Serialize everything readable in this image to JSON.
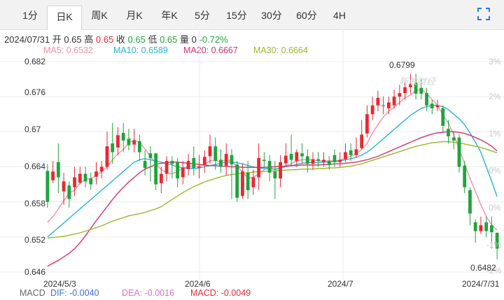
{
  "tabs": [
    {
      "label": "1分",
      "active": false
    },
    {
      "label": "日K",
      "active": true
    },
    {
      "label": "周K",
      "active": false
    },
    {
      "label": "月K",
      "active": false
    },
    {
      "label": "年K",
      "active": false
    },
    {
      "label": "5分",
      "active": false
    },
    {
      "label": "15分",
      "active": false
    },
    {
      "label": "30分",
      "active": false
    },
    {
      "label": "60分",
      "active": false
    },
    {
      "label": "4H",
      "active": false
    }
  ],
  "info": {
    "date": "2024/07/31",
    "open_label": "开",
    "open": "0.65",
    "high_label": "高",
    "high": "0.65",
    "close_label": "收",
    "close": "0.65",
    "low_label": "低",
    "low": "0.65",
    "vol_label": "量",
    "vol": "0",
    "change": "-0.72%"
  },
  "ma_legend": [
    {
      "text": "MA5: 0.6532",
      "color": "#f58fa5"
    },
    {
      "text": "MA10: 0.6589",
      "color": "#27b4d8"
    },
    {
      "text": "MA20: 0.6667",
      "color": "#d9326a"
    },
    {
      "text": "MA30: 0.6664",
      "color": "#9ab92a"
    }
  ],
  "macd_legend": {
    "title": "MACD",
    "dif": "DIF: -0.0040",
    "dea": "DEA: -0.0016",
    "macd": "MACD: -0.0049"
  },
  "watermark": "新浪财经",
  "colors": {
    "up": "#e8292e",
    "down": "#1fa43c",
    "grid": "#ececec"
  },
  "chart_data": {
    "type": "candlestick",
    "price_ticks": [
      "0.682",
      "0.676",
      "0.67",
      "0.664",
      "0.658",
      "0.652",
      "0.646"
    ],
    "pct_ticks": [
      "3%",
      "2%",
      "1%",
      "0%",
      "0%",
      "-1%",
      "-2%"
    ],
    "date_ticks": [
      "2024/5/3",
      "2024/6",
      "2024/7",
      "2024/7/31"
    ],
    "ylim": [
      0.646,
      0.682
    ],
    "high_mark": "0.6799",
    "low_mark": "0.6482",
    "candles": [
      [
        0.6633,
        0.658,
        0.6645,
        0.657
      ],
      [
        0.6617,
        0.6632,
        0.665,
        0.6612
      ],
      [
        0.6648,
        0.6622,
        0.668,
        0.6595
      ],
      [
        0.6598,
        0.6615,
        0.663,
        0.6575
      ],
      [
        0.6608,
        0.6585,
        0.6615,
        0.657
      ],
      [
        0.6605,
        0.6622,
        0.664,
        0.659
      ],
      [
        0.6613,
        0.6628,
        0.664,
        0.661
      ],
      [
        0.6628,
        0.6615,
        0.664,
        0.6605
      ],
      [
        0.662,
        0.661,
        0.663,
        0.66
      ],
      [
        0.6623,
        0.6632,
        0.6648,
        0.661
      ],
      [
        0.6632,
        0.664,
        0.665,
        0.662
      ],
      [
        0.664,
        0.6675,
        0.67,
        0.6635
      ],
      [
        0.668,
        0.6665,
        0.6715,
        0.6645
      ],
      [
        0.6673,
        0.6694,
        0.6708,
        0.666
      ],
      [
        0.6698,
        0.6685,
        0.6715,
        0.6665
      ],
      [
        0.6688,
        0.6677,
        0.6705,
        0.6668
      ],
      [
        0.6678,
        0.6685,
        0.6705,
        0.6665
      ],
      [
        0.6684,
        0.6665,
        0.6695,
        0.665
      ],
      [
        0.665,
        0.6638,
        0.6668,
        0.6625
      ],
      [
        0.6663,
        0.6655,
        0.6675,
        0.6615
      ],
      [
        0.6663,
        0.661,
        0.6655,
        0.66
      ],
      [
        0.6612,
        0.6628,
        0.664,
        0.6595
      ],
      [
        0.6628,
        0.665,
        0.6658,
        0.6615
      ],
      [
        0.665,
        0.6645,
        0.6658,
        0.662
      ],
      [
        0.6648,
        0.662,
        0.6655,
        0.6605
      ],
      [
        0.6622,
        0.6638,
        0.665,
        0.661
      ],
      [
        0.6636,
        0.665,
        0.6662,
        0.6625
      ],
      [
        0.6655,
        0.6638,
        0.6675,
        0.6625
      ],
      [
        0.6638,
        0.664,
        0.666,
        0.662
      ],
      [
        0.6643,
        0.6657,
        0.6668,
        0.663
      ],
      [
        0.6658,
        0.6675,
        0.6695,
        0.6645
      ],
      [
        0.6675,
        0.665,
        0.669,
        0.6635
      ],
      [
        0.6652,
        0.664,
        0.667,
        0.663
      ],
      [
        0.6642,
        0.6662,
        0.668,
        0.6625
      ],
      [
        0.666,
        0.6644,
        0.667,
        0.6585
      ],
      [
        0.6644,
        0.6587,
        0.665,
        0.658
      ],
      [
        0.659,
        0.6632,
        0.6645,
        0.6585
      ],
      [
        0.663,
        0.66,
        0.665,
        0.6585
      ],
      [
        0.6605,
        0.6622,
        0.6635,
        0.6592
      ],
      [
        0.6622,
        0.6655,
        0.668,
        0.66
      ],
      [
        0.6652,
        0.665,
        0.6665,
        0.664
      ],
      [
        0.665,
        0.663,
        0.666,
        0.6615
      ],
      [
        0.6632,
        0.662,
        0.665,
        0.6585
      ],
      [
        0.662,
        0.6648,
        0.666,
        0.6605
      ],
      [
        0.6646,
        0.6659,
        0.668,
        0.664
      ],
      [
        0.6662,
        0.6652,
        0.6695,
        0.664
      ],
      [
        0.665,
        0.6665,
        0.667,
        0.664
      ],
      [
        0.6663,
        0.6658,
        0.668,
        0.6645
      ],
      [
        0.6658,
        0.6645,
        0.667,
        0.663
      ],
      [
        0.6645,
        0.6653,
        0.6665,
        0.6635
      ],
      [
        0.6653,
        0.665,
        0.6665,
        0.664
      ],
      [
        0.6648,
        0.6652,
        0.6665,
        0.664
      ],
      [
        0.665,
        0.6643,
        0.6658,
        0.6635
      ],
      [
        0.666,
        0.6648,
        0.667,
        0.664
      ],
      [
        0.6648,
        0.6652,
        0.6665,
        0.664
      ],
      [
        0.6653,
        0.6665,
        0.668,
        0.6648
      ],
      [
        0.6668,
        0.666,
        0.668,
        0.665
      ],
      [
        0.666,
        0.667,
        0.669,
        0.6655
      ],
      [
        0.6672,
        0.6695,
        0.672,
        0.667
      ],
      [
        0.6697,
        0.673,
        0.6745,
        0.669
      ],
      [
        0.673,
        0.6745,
        0.676,
        0.672
      ],
      [
        0.6745,
        0.6758,
        0.677,
        0.6735
      ],
      [
        0.6745,
        0.6745,
        0.676,
        0.673
      ],
      [
        0.674,
        0.675,
        0.676,
        0.673
      ],
      [
        0.6745,
        0.676,
        0.6772,
        0.674
      ],
      [
        0.676,
        0.6766,
        0.678,
        0.6745
      ],
      [
        0.6766,
        0.6776,
        0.6786,
        0.6755
      ],
      [
        0.6776,
        0.6782,
        0.6799,
        0.6765
      ],
      [
        0.6784,
        0.6765,
        0.6799,
        0.6755
      ],
      [
        0.6775,
        0.6765,
        0.679,
        0.6755
      ],
      [
        0.6766,
        0.6745,
        0.6775,
        0.6735
      ],
      [
        0.6748,
        0.674,
        0.6755,
        0.673
      ],
      [
        0.6742,
        0.6745,
        0.6755,
        0.6735
      ],
      [
        0.674,
        0.671,
        0.6745,
        0.67
      ],
      [
        0.6705,
        0.6692,
        0.672,
        0.668
      ],
      [
        0.669,
        0.6685,
        0.67,
        0.667
      ],
      [
        0.669,
        0.664,
        0.6695,
        0.663
      ],
      [
        0.6642,
        0.6605,
        0.665,
        0.6595
      ],
      [
        0.66,
        0.656,
        0.6605,
        0.654
      ],
      [
        0.6545,
        0.653,
        0.655,
        0.651
      ],
      [
        0.653,
        0.654,
        0.6555,
        0.6525
      ],
      [
        0.6545,
        0.653,
        0.6555,
        0.652
      ],
      [
        0.654,
        0.6528,
        0.6555,
        0.65
      ],
      [
        0.6527,
        0.65,
        0.6528,
        0.6482
      ]
    ],
    "ma_series": [
      {
        "name": "MA5",
        "color": "#f58fa5",
        "values": [
          0.6545,
          0.6555,
          0.6568,
          0.6582,
          0.6595,
          0.66,
          0.6612,
          0.6618,
          0.662,
          0.6625,
          0.6632,
          0.664,
          0.6652,
          0.6662,
          0.667,
          0.668,
          0.6686,
          0.6682,
          0.667,
          0.6658,
          0.6645,
          0.6635,
          0.663,
          0.6628,
          0.6632,
          0.6638,
          0.664,
          0.6642,
          0.664,
          0.6645,
          0.665,
          0.6651,
          0.6649,
          0.6652,
          0.665,
          0.664,
          0.6632,
          0.662,
          0.6622,
          0.6628,
          0.6635,
          0.664,
          0.6635,
          0.6638,
          0.6642,
          0.6645,
          0.665,
          0.6652,
          0.6652,
          0.6652,
          0.665,
          0.665,
          0.665,
          0.665,
          0.6651,
          0.6655,
          0.6658,
          0.6662,
          0.667,
          0.668,
          0.6698,
          0.6712,
          0.6725,
          0.6735,
          0.6742,
          0.675,
          0.6758,
          0.6763,
          0.677,
          0.6772,
          0.6765,
          0.6755,
          0.6745,
          0.6728,
          0.6715,
          0.6695,
          0.667,
          0.6645,
          0.662,
          0.6598,
          0.6575,
          0.6555,
          0.654,
          0.6532
        ]
      },
      {
        "name": "MA10",
        "color": "#27b4d8",
        "values": [
          0.652,
          0.6528,
          0.6536,
          0.6544,
          0.6552,
          0.656,
          0.6568,
          0.6576,
          0.6584,
          0.6592,
          0.66,
          0.6608,
          0.6616,
          0.6624,
          0.6632,
          0.664,
          0.6648,
          0.6652,
          0.6654,
          0.6652,
          0.665,
          0.6648,
          0.6645,
          0.6643,
          0.664,
          0.6638,
          0.6637,
          0.6637,
          0.6638,
          0.664,
          0.6642,
          0.6644,
          0.6646,
          0.6648,
          0.6648,
          0.6647,
          0.6645,
          0.6642,
          0.664,
          0.6638,
          0.6637,
          0.6636,
          0.6636,
          0.6638,
          0.664,
          0.6642,
          0.6644,
          0.6646,
          0.6647,
          0.6647,
          0.6647,
          0.6648,
          0.6648,
          0.6649,
          0.665,
          0.6652,
          0.6654,
          0.6656,
          0.666,
          0.6665,
          0.6672,
          0.668,
          0.6688,
          0.6696,
          0.6704,
          0.6712,
          0.672,
          0.6728,
          0.6734,
          0.674,
          0.6743,
          0.6745,
          0.6745,
          0.6743,
          0.6738,
          0.673,
          0.6722,
          0.6712,
          0.6698,
          0.6682,
          0.6665,
          0.664,
          0.6615,
          0.6589
        ]
      },
      {
        "name": "MA20",
        "color": "#d9326a",
        "values": [
          0.647,
          0.6475,
          0.648,
          0.6486,
          0.6492,
          0.65,
          0.651,
          0.6522,
          0.6535,
          0.6548,
          0.656,
          0.6572,
          0.6584,
          0.6595,
          0.6605,
          0.6614,
          0.6622,
          0.663,
          0.6636,
          0.664,
          0.6644,
          0.6646,
          0.6647,
          0.6648,
          0.6648,
          0.6647,
          0.6646,
          0.6645,
          0.6644,
          0.6643,
          0.6642,
          0.6642,
          0.6641,
          0.6641,
          0.664,
          0.664,
          0.6639,
          0.6639,
          0.6639,
          0.6639,
          0.6639,
          0.664,
          0.664,
          0.6641,
          0.6641,
          0.6642,
          0.6642,
          0.6643,
          0.6643,
          0.6643,
          0.6643,
          0.6644,
          0.6644,
          0.6645,
          0.6645,
          0.6646,
          0.6647,
          0.6648,
          0.665,
          0.6652,
          0.6655,
          0.6658,
          0.6662,
          0.6666,
          0.667,
          0.6674,
          0.6678,
          0.6682,
          0.6686,
          0.669,
          0.6693,
          0.6696,
          0.6698,
          0.6699,
          0.67,
          0.67,
          0.6699,
          0.6697,
          0.6694,
          0.669,
          0.6686,
          0.6681,
          0.6675,
          0.6667
        ]
      },
      {
        "name": "MA30",
        "color": "#9ab92a",
        "values": [
          0.6518,
          0.6519,
          0.652,
          0.6521,
          0.6523,
          0.6525,
          0.6527,
          0.653,
          0.6533,
          0.6536,
          0.6539,
          0.6543,
          0.6547,
          0.655,
          0.6553,
          0.6556,
          0.6558,
          0.656,
          0.6562,
          0.6565,
          0.6568,
          0.6572,
          0.6578,
          0.6584,
          0.659,
          0.6596,
          0.6601,
          0.6606,
          0.661,
          0.6614,
          0.6617,
          0.662,
          0.6623,
          0.6625,
          0.6627,
          0.6628,
          0.6629,
          0.663,
          0.6631,
          0.6632,
          0.6632,
          0.6633,
          0.6633,
          0.6634,
          0.6634,
          0.6635,
          0.6635,
          0.6636,
          0.6636,
          0.6636,
          0.6637,
          0.6637,
          0.6638,
          0.6638,
          0.6639,
          0.664,
          0.6641,
          0.6643,
          0.6645,
          0.6648,
          0.6651,
          0.6654,
          0.6657,
          0.666,
          0.6663,
          0.6666,
          0.6669,
          0.6672,
          0.6675,
          0.6677,
          0.6679,
          0.6681,
          0.6682,
          0.6683,
          0.6683,
          0.6682,
          0.6681,
          0.6679,
          0.6677,
          0.6675,
          0.6673,
          0.667,
          0.6667,
          0.6664
        ]
      }
    ]
  }
}
